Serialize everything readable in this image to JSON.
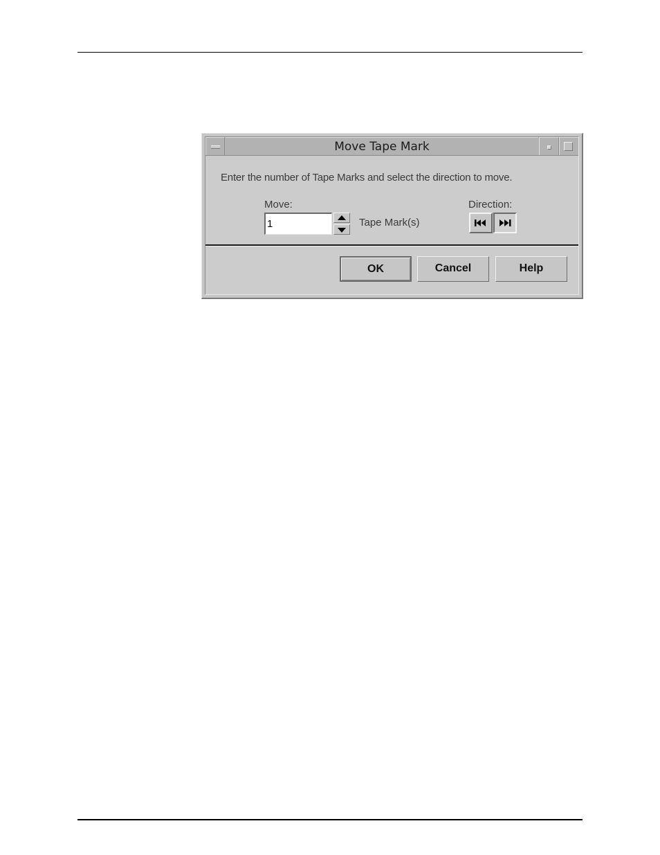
{
  "window": {
    "title": "Move Tape Mark"
  },
  "dialog": {
    "instruction": "Enter the number of Tape Marks and select the direction to move.",
    "move": {
      "label": "Move:",
      "value": "1",
      "unit_label": "Tape Mark(s)"
    },
    "direction": {
      "label": "Direction:",
      "options": [
        {
          "name": "rewind",
          "glyph": "⏮",
          "selected": false
        },
        {
          "name": "forward",
          "glyph": "⏭",
          "selected": true
        }
      ]
    },
    "buttons": {
      "ok": "OK",
      "cancel": "Cancel",
      "help": "Help"
    }
  }
}
